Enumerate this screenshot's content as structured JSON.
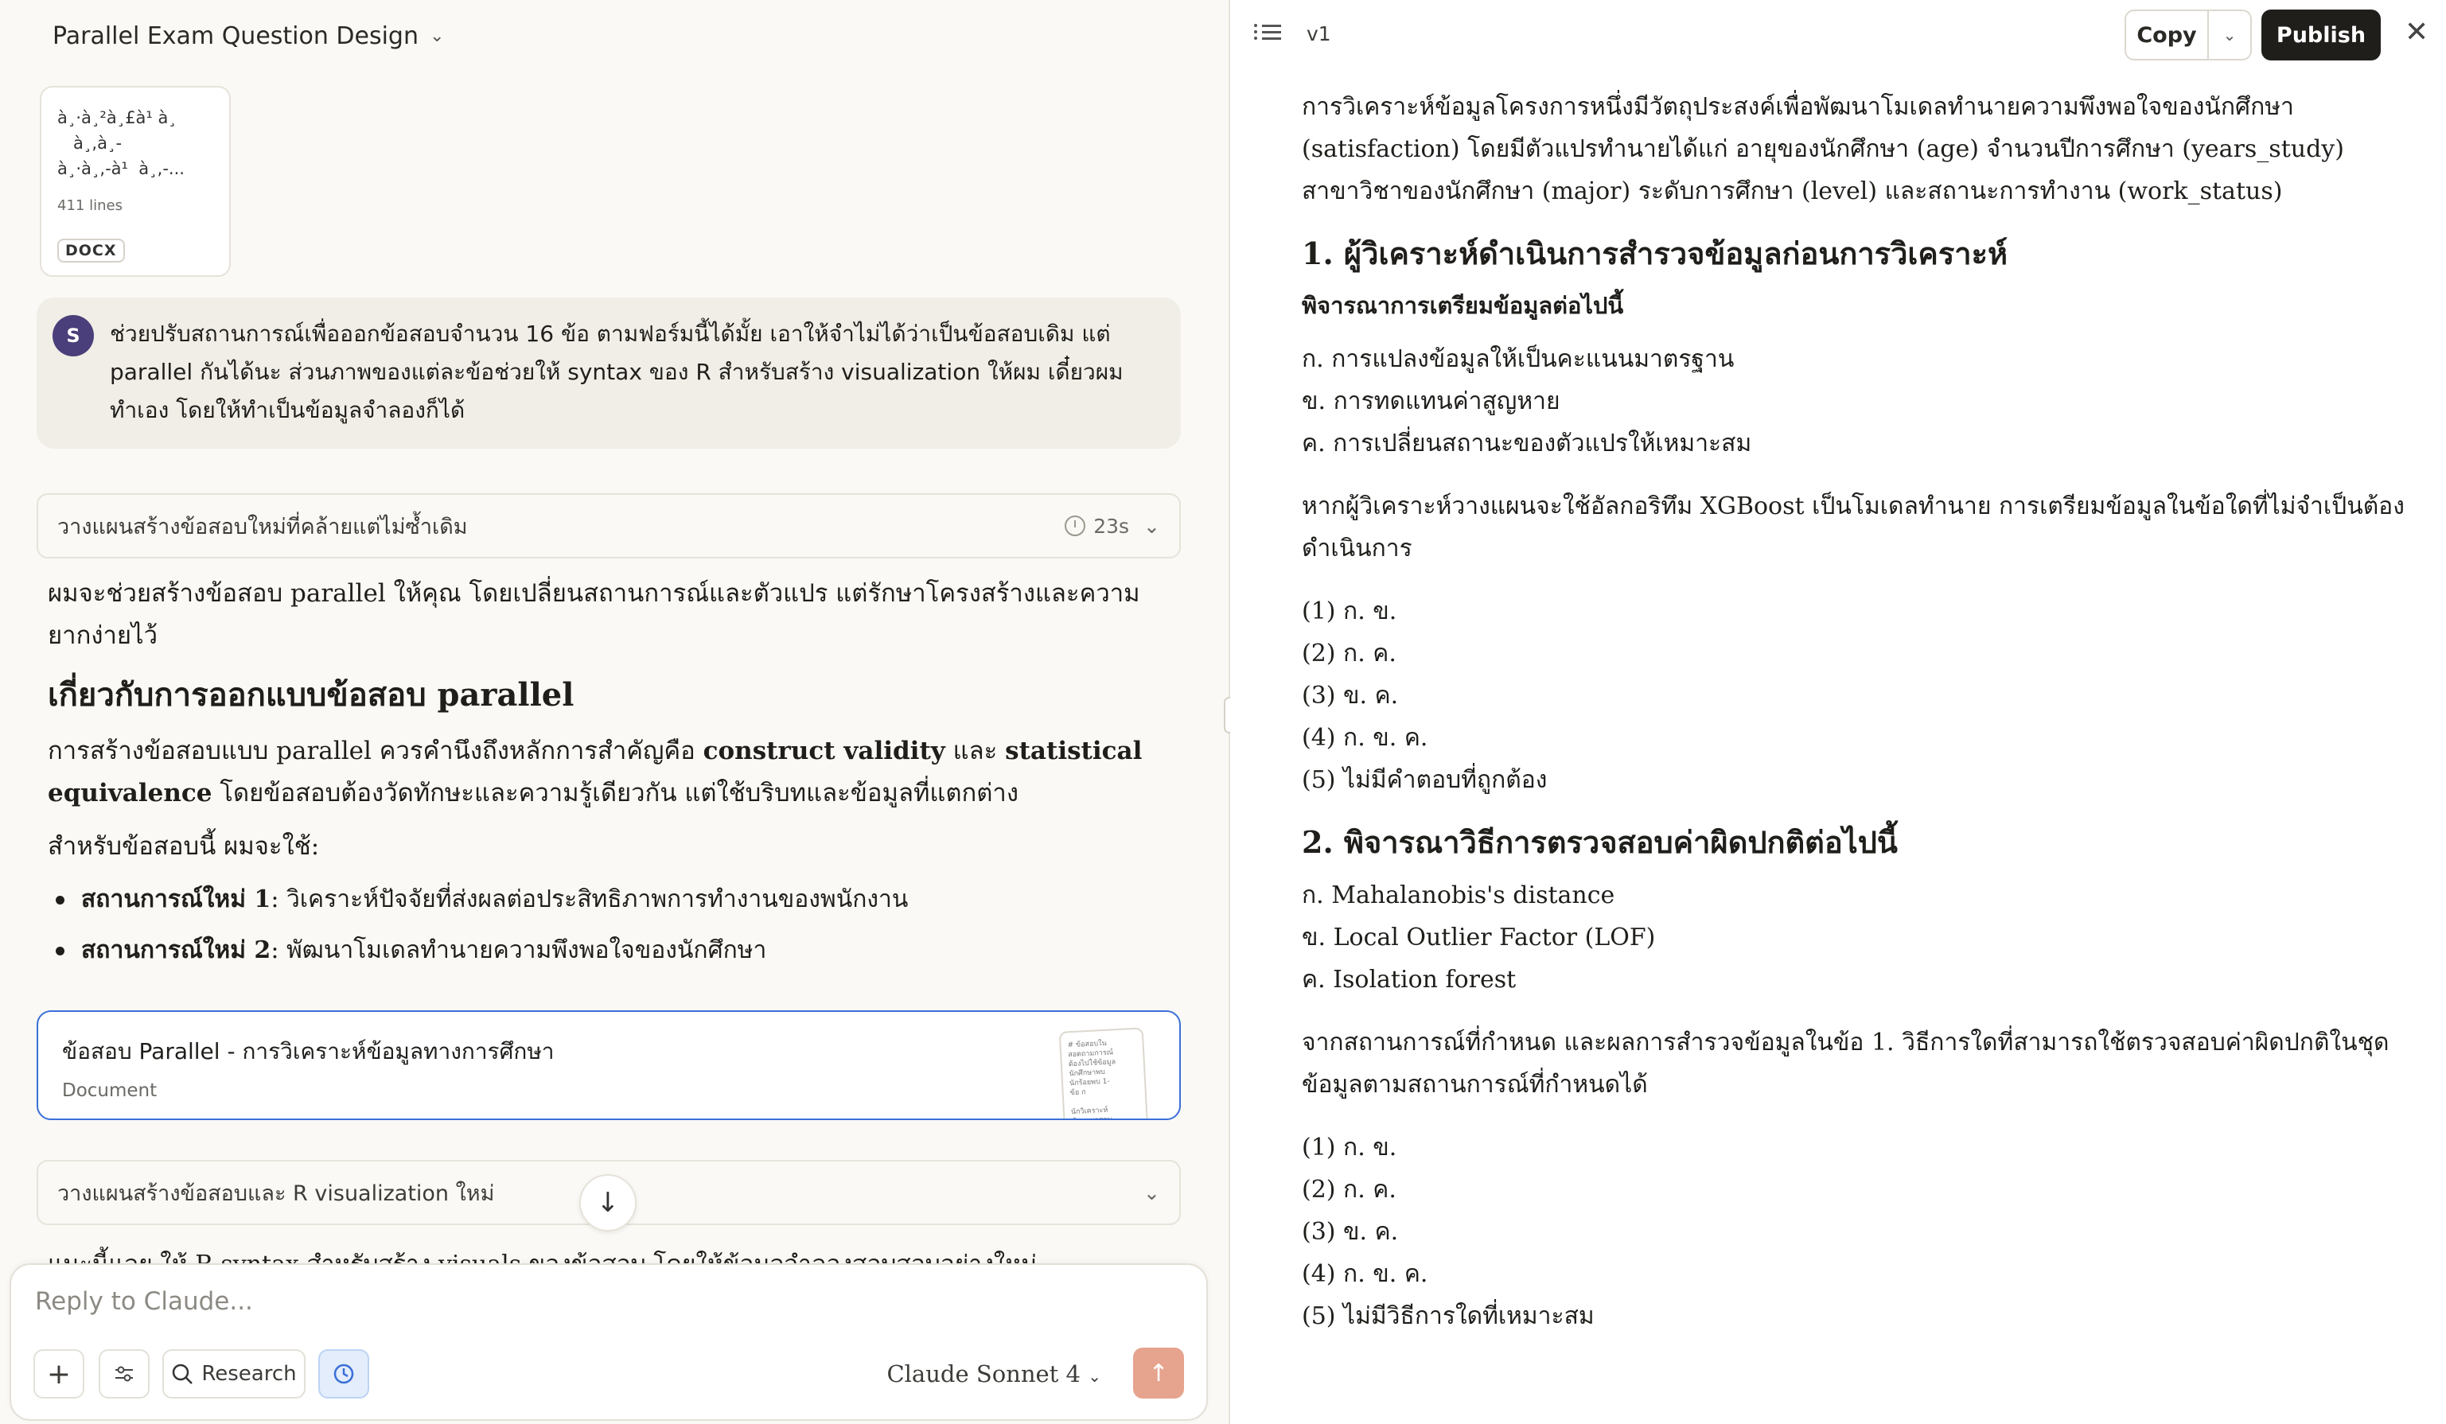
{
  "chat": {
    "title": "Parallel Exam Question Design",
    "attachment": {
      "preview": "à¸·à¸²à¸£à¹ à¸\n   à¸,à¸-\nà¸·à¸,-à¹  à¸,-...",
      "lines": "411 lines",
      "badge": "DOCX"
    },
    "user": {
      "initial": "S",
      "message": "ช่วยปรับสถานการณ์เพื่อออกข้อสอบจำนวน 16 ข้อ ตามฟอร์มนี้ได้มั้ย เอาให้จำไม่ได้ว่าเป็นข้อสอบเดิม แต่ parallel กันได้นะ ส่วนภาพของแต่ละข้อช่วยให้ syntax ของ R สำหรับสร้าง visualization ให้ผม เดี๋ยวผมทำเอง โดยให้ทำเป็นข้อมูลจำลองก็ได้"
    },
    "thought1": {
      "label": "วางแผนสร้างข้อสอบใหม่ที่คล้ายแต่ไม่ซ้ำเดิม",
      "duration": "23s"
    },
    "assistant": {
      "intro": "ผมจะช่วยสร้างข้อสอบ parallel ให้คุณ โดยเปลี่ยนสถานการณ์และตัวแปร แต่รักษาโครงสร้างและความยากง่ายไว้",
      "heading": "เกี่ยวกับการออกแบบข้อสอบ parallel",
      "para_a": "การสร้างข้อสอบแบบ parallel ควรคำนึงถึงหลักการสำคัญคือ ",
      "bold1": "construct validity",
      "para_b": " และ ",
      "bold2": "statistical equivalence",
      "para_c": " โดยข้อสอบต้องวัดทักษะและความรู้เดียวกัน แต่ใช้บริบทและข้อมูลที่แตกต่าง",
      "for_this": "สำหรับข้อสอบนี้ ผมจะใช้:",
      "bullets": [
        {
          "label": "สถานการณ์ใหม่ 1",
          "text": ": วิเคราะห์ปัจจัยที่ส่งผลต่อประสิทธิภาพการทำงานของพนักงาน"
        },
        {
          "label": "สถานการณ์ใหม่ 2",
          "text": ": พัฒนาโมเดลทำนายความพึงพอใจของนักศึกษา"
        }
      ]
    },
    "artifact": {
      "title": "ข้อสอบ Parallel - การวิเคราะห์ข้อมูลทางการศึกษา",
      "type": "Document",
      "thumb_text": "# ข้อสอบใน\nสอดถามการณ์\nต้องไปใช้ข้อมูล\nนักศึกษาพบ\nนักร้อยพบ 1-\nข้อ ก\n\nนักวิเคราะห์\nข้อมูลพอสอบ"
    },
    "thought2": {
      "label": "วางแผนสร้างข้อสอบและ R visualization ใหม่"
    },
    "cut_text": "แนะนี้แลย ให้ R syntax สำหรับสร้าง visuals ของข้อสอบ โดยให้ข้อมูลจำลองสอบสอบอย่างใหม่",
    "composer": {
      "placeholder": "Reply to Claude...",
      "research_label": "Research",
      "model": "Claude Sonnet 4"
    }
  },
  "artifact_panel": {
    "version": "v1",
    "copy_label": "Copy",
    "publish_label": "Publish",
    "intro": "การวิเคราะห์ข้อมูลโครงการหนึ่งมีวัตถุประสงค์เพื่อพัฒนาโมเดลทำนายความพึงพอใจของนักศึกษา (satisfaction) โดยมีตัวแปรทำนายได้แก่ อายุของนักศึกษา (age) จำนวนปีการศึกษา (years_study) สาขาวิชาของนักศึกษา (major) ระดับการศึกษา (level) และสถานะการทำงาน (work_status)",
    "q1": {
      "title": "1. ผู้วิเคราะห์ดำเนินการสำรวจข้อมูลก่อนการวิเคราะห์",
      "subtitle": "พิจารณาการเตรียมข้อมูลต่อไปนี้",
      "items": [
        "ก. การแปลงข้อมูลให้เป็นคะแนนมาตรฐาน",
        "ข. การทดแทนค่าสูญหาย",
        "ค. การเปลี่ยนสถานะของตัวแปรให้เหมาะสม"
      ],
      "stem": "หากผู้วิเคราะห์วางแผนจะใช้อัลกอริทึม XGBoost เป็นโมเดลทำนาย การเตรียมข้อมูลในข้อใดที่ไม่จำเป็นต้องดำเนินการ",
      "choices": [
        "(1) ก. ข.",
        "(2) ก. ค.",
        "(3) ข. ค.",
        "(4) ก. ข. ค.",
        "(5) ไม่มีคำตอบที่ถูกต้อง"
      ]
    },
    "q2": {
      "title": "2. พิจารณาวิธีการตรวจสอบค่าผิดปกติต่อไปนี้",
      "items": [
        "ก. Mahalanobis's distance",
        "ข. Local Outlier Factor (LOF)",
        "ค. Isolation forest"
      ],
      "stem": "จากสถานการณ์ที่กำหนด และผลการสำรวจข้อมูลในข้อ 1. วิธีการใดที่สามารถใช้ตรวจสอบค่าผิดปกติในชุดข้อมูลตามสถานการณ์ที่กำหนดได้",
      "choices": [
        "(1) ก. ข.",
        "(2) ก. ค.",
        "(3) ข. ค.",
        "(4) ก. ข. ค.",
        "(5) ไม่มีวิธีการใดที่เหมาะสม"
      ]
    }
  },
  "icons": [
    "chevron-down-icon",
    "clock-icon",
    "arrow-down-icon",
    "plus-icon",
    "sliders-icon",
    "search-icon",
    "arrow-up-icon",
    "list-icon",
    "close-icon"
  ],
  "colors": {
    "background": "#faf9f5",
    "accent_blue": "#3a6fd8",
    "send": "#e6a38d",
    "publish": "#1f1e1b",
    "avatar": "#4a3f7a"
  }
}
